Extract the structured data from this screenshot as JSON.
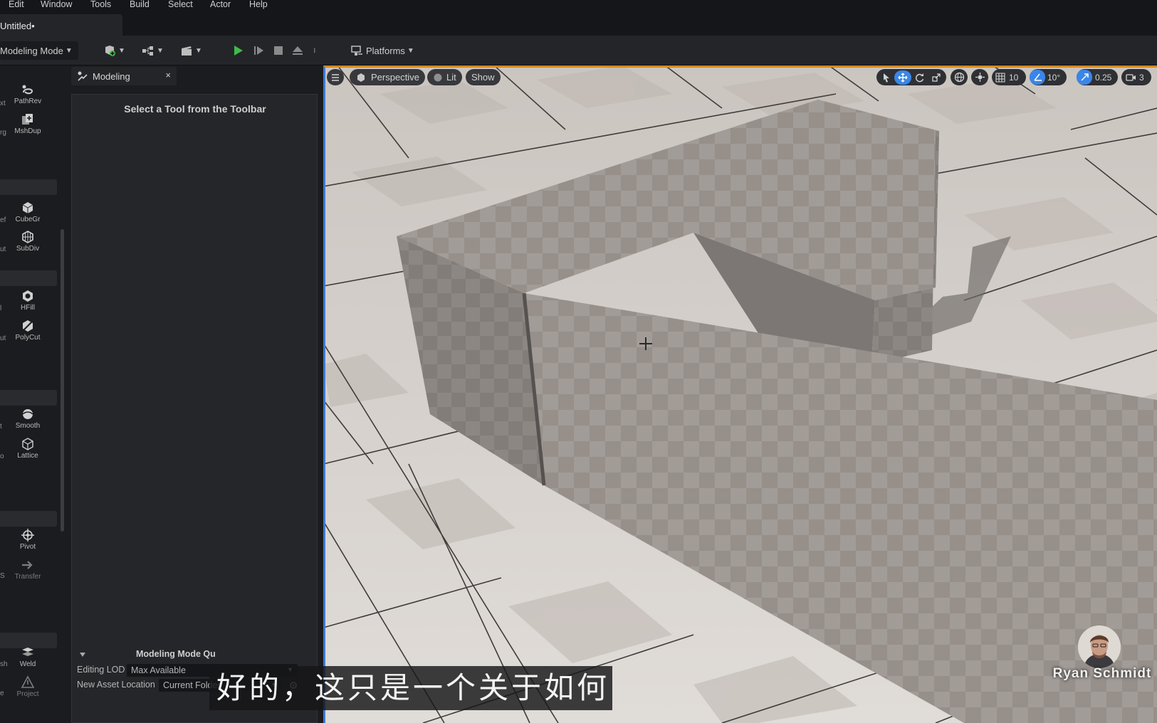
{
  "menu": [
    "Edit",
    "Window",
    "Tools",
    "Build",
    "Select",
    "Actor",
    "Help"
  ],
  "document_tab": "Untitled•",
  "toolbar": {
    "mode_label": "Modeling Mode",
    "platforms_label": "Platforms"
  },
  "left_tools": [
    {
      "frag": "xt",
      "label": "PathRev",
      "icon": "path-revolve-icon"
    },
    {
      "frag": "rg",
      "label": "MshDup",
      "icon": "mesh-duplicate-icon"
    },
    {
      "frag": "ef",
      "label": "CubeGr",
      "icon": "cube-grid-icon"
    },
    {
      "frag": "ut",
      "label": "SubDiv",
      "icon": "subdivide-icon"
    },
    {
      "frag": "l",
      "label": "HFill",
      "icon": "hole-fill-icon"
    },
    {
      "frag": "ut",
      "label": "PolyCut",
      "icon": "poly-cut-icon"
    },
    {
      "frag": "t",
      "label": "Smooth",
      "icon": "smooth-icon"
    },
    {
      "frag": "o",
      "label": "Lattice",
      "icon": "lattice-icon"
    },
    {
      "frag": "",
      "label": "Pivot",
      "icon": "pivot-icon"
    },
    {
      "frag": "S",
      "label": "Transfer",
      "icon": "transfer-icon"
    },
    {
      "frag": "sh",
      "label": "Weld",
      "icon": "weld-icon"
    },
    {
      "frag": "e",
      "label": "Project",
      "icon": "project-icon"
    }
  ],
  "panel": {
    "tab_label": "Modeling",
    "close_glyph": "×",
    "title": "Select a Tool from the Toolbar",
    "section_label": "Modeling Mode Qu",
    "editing_lod_label": "Editing LOD",
    "editing_lod_value": "Max Available",
    "asset_location_label": "New Asset Location",
    "asset_location_value": "Current Folder"
  },
  "viewport": {
    "perspective_label": "Perspective",
    "lit_label": "Lit",
    "show_label": "Show",
    "grid_snap": "10",
    "rotation_snap": "10°",
    "scale_snap": "0.25",
    "camera_speed": "3"
  },
  "overlay": {
    "subtitle": "好的，这只是一个关于如何",
    "presenter_name": "Ryan Schmidt"
  },
  "colors": {
    "accent_blue": "#3a86e8",
    "viewport_border_orange": "#d38a21",
    "play_green": "#3fb94a"
  }
}
